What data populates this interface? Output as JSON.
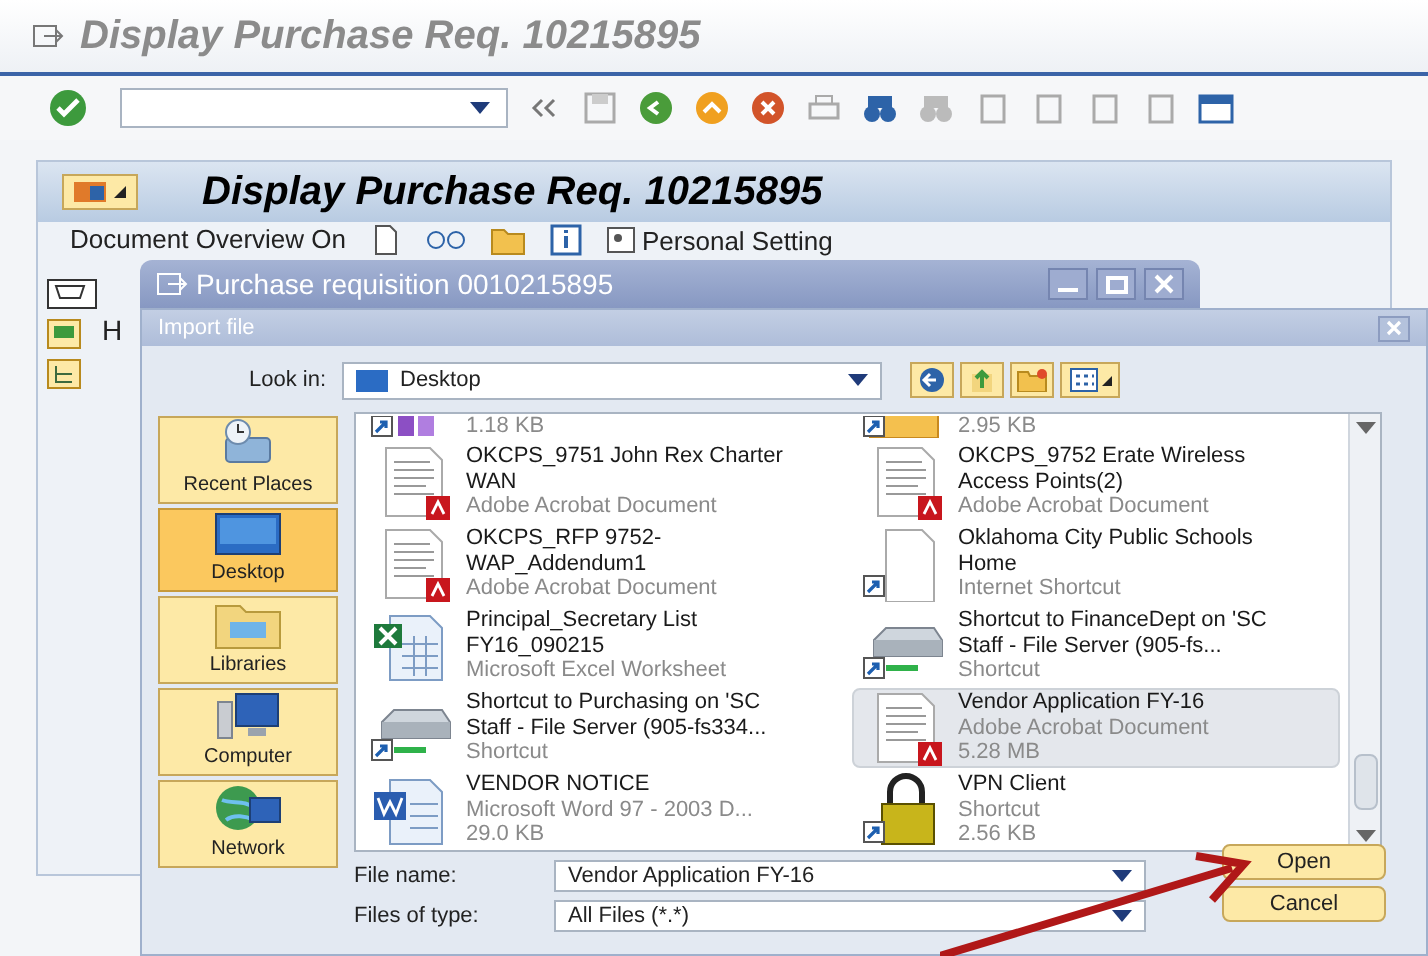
{
  "window": {
    "title": "Display Purchase Req. 10215895"
  },
  "screen": {
    "title": "Display Purchase Req. 10215895",
    "toolbar": [
      {
        "label": "Document Overview On"
      },
      {
        "label": "Personal Setting"
      }
    ],
    "side_label": "H"
  },
  "dialog": {
    "title": "Purchase requisition 0010215895",
    "import_file": {
      "title": "Import file",
      "look_in_label": "Look in:",
      "look_in_value": "Desktop",
      "places": [
        {
          "label": "Recent Places",
          "kind": "recent",
          "selected": false
        },
        {
          "label": "Desktop",
          "kind": "desktop",
          "selected": true
        },
        {
          "label": "Libraries",
          "kind": "libraries",
          "selected": false
        },
        {
          "label": "Computer",
          "kind": "computer",
          "selected": false
        },
        {
          "label": "Network",
          "kind": "network",
          "selected": false
        }
      ],
      "columns": [
        [
          {
            "kind": "shortcut",
            "lines": [
              "1.18 KB"
            ],
            "selected": false
          },
          {
            "kind": "pdf",
            "name": "OKCPS_9751 John Rex Charter WAN",
            "lines": [
              "Adobe Acrobat Document"
            ],
            "selected": false
          },
          {
            "kind": "pdf",
            "name": "OKCPS_RFP 9752-WAP_Addendum1",
            "lines": [
              "Adobe Acrobat Document"
            ],
            "selected": false
          },
          {
            "kind": "excel",
            "name": "Principal_Secretary List FY16_090215",
            "lines": [
              "Microsoft Excel Worksheet"
            ],
            "selected": false
          },
          {
            "kind": "drive",
            "name": "Shortcut to Purchasing on 'SC Staff - File Server (905-fs334...",
            "lines": [
              "Shortcut"
            ],
            "selected": false
          },
          {
            "kind": "word",
            "name": "VENDOR NOTICE",
            "lines": [
              "Microsoft Word 97 - 2003 D...",
              "29.0 KB"
            ],
            "selected": false
          }
        ],
        [
          {
            "kind": "mail",
            "lines": [
              "2.95 KB"
            ],
            "selected": false
          },
          {
            "kind": "pdf",
            "name": "OKCPS_9752 Erate Wireless Access Points(2)",
            "lines": [
              "Adobe Acrobat Document"
            ],
            "selected": false
          },
          {
            "kind": "web",
            "name": "Oklahoma City Public Schools Home",
            "lines": [
              "Internet Shortcut"
            ],
            "selected": false
          },
          {
            "kind": "drive",
            "name": "Shortcut to FinanceDept on 'SC Staff - File Server (905-fs...",
            "lines": [
              "Shortcut"
            ],
            "selected": false
          },
          {
            "kind": "pdf",
            "name": "Vendor Application FY-16",
            "lines": [
              "Adobe Acrobat Document",
              "5.28 MB"
            ],
            "selected": true
          },
          {
            "kind": "lock",
            "name": "VPN Client",
            "lines": [
              "Shortcut",
              "2.56 KB"
            ],
            "selected": false
          }
        ]
      ],
      "file_name_label": "File name:",
      "file_name_value": "Vendor Application FY-16",
      "file_type_label": "Files of type:",
      "file_type_value": "All Files (*.*)",
      "buttons": [
        "Open",
        "Cancel"
      ]
    }
  }
}
